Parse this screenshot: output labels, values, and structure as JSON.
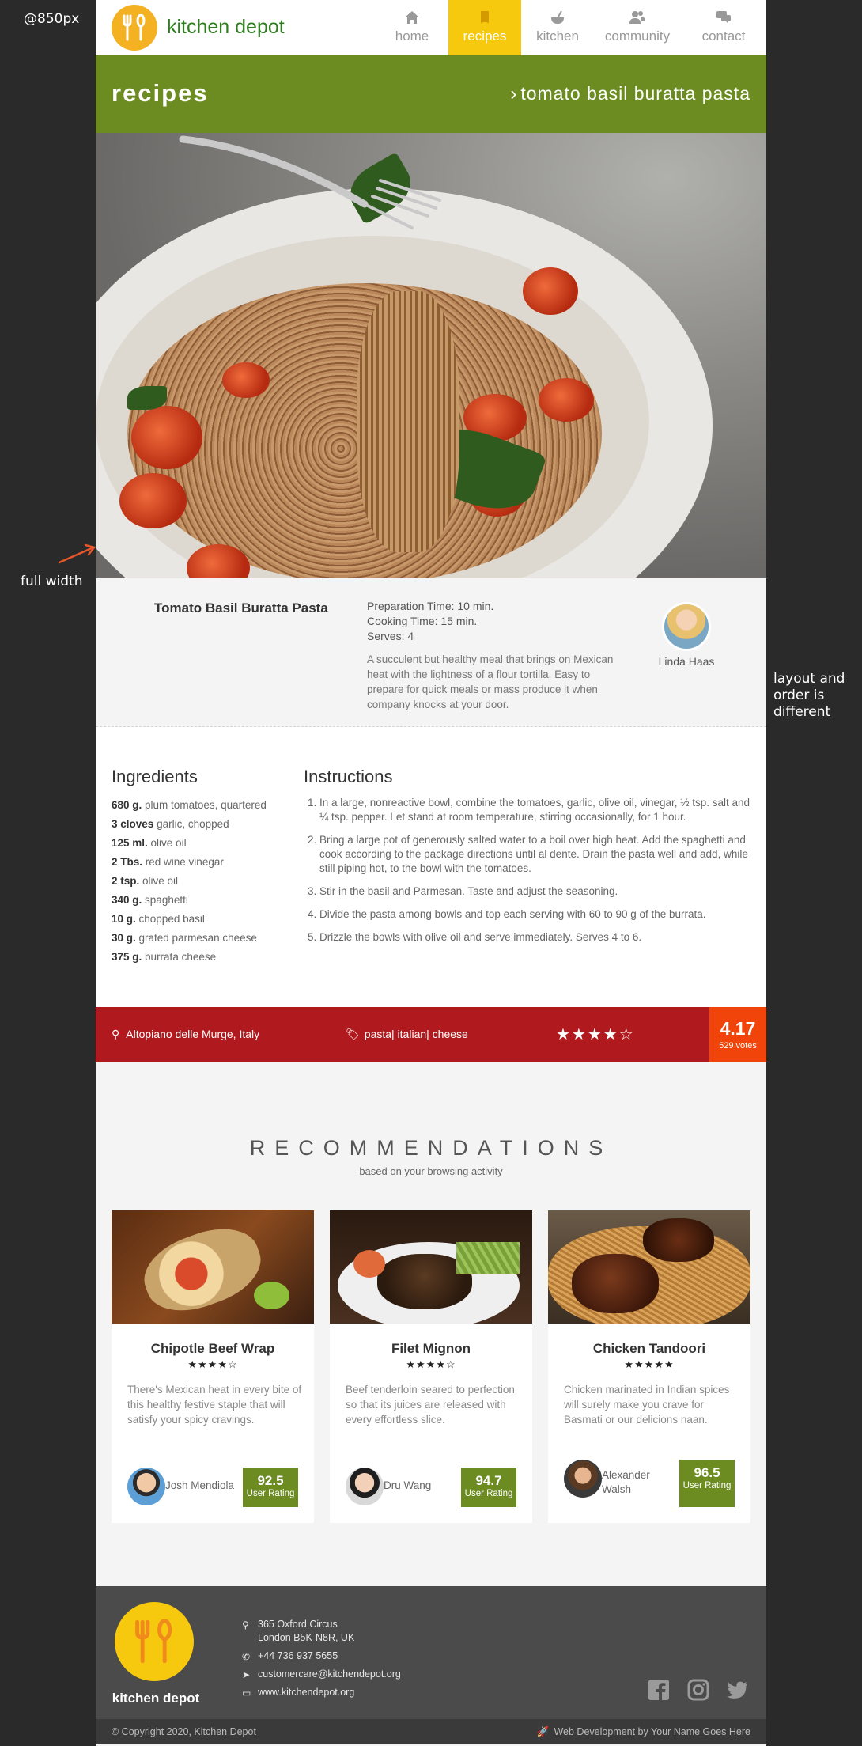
{
  "viewport_label": "@850px",
  "annotations": {
    "full_width": "full width",
    "layout_order": "layout and order is different"
  },
  "header": {
    "brand": "kitchen depot",
    "nav": [
      {
        "label": "home",
        "icon": "home-icon"
      },
      {
        "label": "recipes",
        "icon": "book-icon",
        "active": true
      },
      {
        "label": "kitchen",
        "icon": "bowl-icon"
      },
      {
        "label": "community",
        "icon": "users-icon"
      },
      {
        "label": "contact",
        "icon": "chat-icon"
      }
    ]
  },
  "titlebar": {
    "section": "recipes",
    "breadcrumb": "tomato basil buratta pasta"
  },
  "recipe": {
    "name": "Tomato Basil Buratta Pasta",
    "prep_label": "Preparation Time:",
    "prep_value": "10 min.",
    "cook_label": "Cooking Time:",
    "cook_value": "15 min.",
    "serves_label": "Serves:",
    "serves_value": "4",
    "description": "A succulent but healthy meal that brings on Mexican heat with the lightness of a flour tortilla. Easy to prepare for quick meals or mass produce it when company knocks at your door.",
    "author": "Linda Haas"
  },
  "ingredients": {
    "title": "Ingredients",
    "items": [
      {
        "qty": "680 g.",
        "name": "plum tomatoes, quartered"
      },
      {
        "qty": "3 cloves",
        "name": "garlic, chopped"
      },
      {
        "qty": "125 ml.",
        "name": "olive oil"
      },
      {
        "qty": "2 Tbs.",
        "name": "red wine vinegar"
      },
      {
        "qty": "2 tsp.",
        "name": "olive oil"
      },
      {
        "qty": "340 g.",
        "name": "spaghetti"
      },
      {
        "qty": "10 g.",
        "name": "chopped basil"
      },
      {
        "qty": "30 g.",
        "name": "grated parmesan cheese"
      },
      {
        "qty": "375 g.",
        "name": "burrata cheese"
      }
    ]
  },
  "instructions": {
    "title": "Instructions",
    "steps": [
      "In a large, nonreactive bowl, combine the tomatoes, garlic, olive oil, vinegar, ½ tsp. salt and ¼ tsp. pepper. Let stand at room temperature, stirring occasionally, for 1 hour.",
      "Bring a large pot of generously salted water to a boil over high heat. Add the spaghetti and cook according to the package directions until al dente. Drain the pasta well and add, while still piping hot, to the bowl with the tomatoes.",
      "Stir in the basil and Parmesan. Taste and adjust the seasoning.",
      "Divide the pasta among bowls and top each serving with 60 to 90 g of the burrata.",
      "Drizzle the bowls with olive oil and serve immediately. Serves 4 to 6."
    ]
  },
  "strip": {
    "location": "Altopiano delle Murge, Italy",
    "tags": "pasta| italian| cheese",
    "stars": "★★★★☆",
    "score": "4.17",
    "votes": "529 votes"
  },
  "recommendations": {
    "title": "RECOMMENDATIONS",
    "subtitle": "based on your browsing activity",
    "cards": [
      {
        "name": "Chipotle Beef Wrap",
        "stars": "★★★★☆",
        "description": "There's Mexican heat in every bite of this healthy festive staple that will satisfy your spicy cravings.",
        "user": "Josh Mendiola",
        "rating": "92.5",
        "rating_label": "User Rating"
      },
      {
        "name": "Filet Mignon",
        "stars": "★★★★☆",
        "description": "Beef tenderloin seared to perfection so that its juices are released with every effortless slice.",
        "user": "Dru Wang",
        "rating": "94.7",
        "rating_label": "User Rating"
      },
      {
        "name": "Chicken Tandoori",
        "stars": "★★★★★",
        "description": "Chicken marinated in Indian spices will surely make you crave for Basmati or our delicions naan.",
        "user": "Alexander Walsh",
        "rating": "96.5",
        "rating_label": "User Rating"
      }
    ]
  },
  "footer": {
    "brand": "kitchen depot",
    "address_line1": "365 Oxford Circus",
    "address_line2": "London B5K-N8R, UK",
    "phone": "+44 736 937 5655",
    "email": "customercare@kitchendepot.org",
    "website": "www.kitchendepot.org",
    "copyright": "© Copyright 2020, Kitchen Depot",
    "credit": "Web Development by Your Name Goes Here"
  },
  "colors": {
    "accent_green": "#6c8c21",
    "nav_active": "#f6c90e",
    "strip_red": "#b0191e",
    "score_orange": "#f1440a",
    "annotation_arrow": "#e8572a"
  }
}
